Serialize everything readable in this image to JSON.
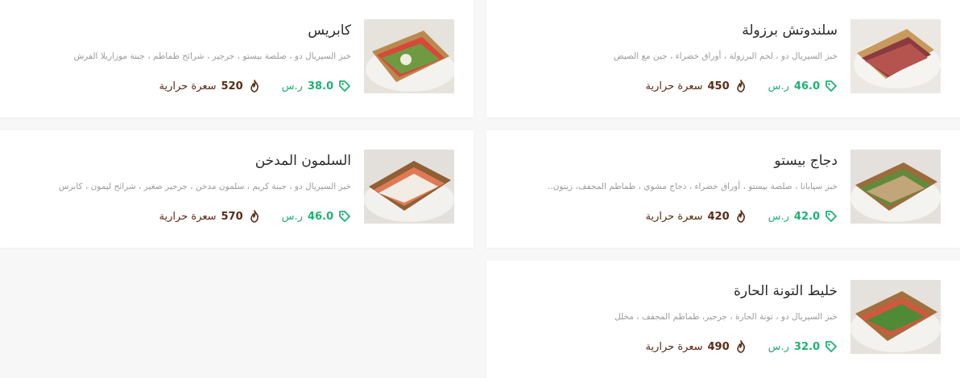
{
  "items": [
    {
      "title": "سلندوتش برزولة",
      "desc": "خبز السيريال دو ، لحم البرزولة ، أوراق خضراء ، جبن مع الصيض",
      "price": "46.0",
      "currency": "ر.س",
      "calories": "450",
      "cal_label": "سعرة حرارية"
    },
    {
      "title": "كابريس",
      "desc": "خبز السيريال دو ، صلصة بيستو ، جرجير ، شرائح طماطم ، جبنة موزاريلا الفرش",
      "price": "38.0",
      "currency": "ر.س",
      "calories": "520",
      "cal_label": "سعرة حرارية"
    },
    {
      "title": "دجاج بيستو",
      "desc": "خبز سيابانا ، صلصة بيستو ، أوراق خضراء ، دجاج مشوي ، طماطم المجفف، زيتون..",
      "price": "42.0",
      "currency": "ر.س",
      "calories": "420",
      "cal_label": "سعرة حرارية"
    },
    {
      "title": "السلمون المدخن",
      "desc": "خبز السيريال دو ، جبنة كريم ، سلمون مدخن ، جرجير صغير ، شرائح ليمون ، كابرس",
      "price": "46.0",
      "currency": "ر.س",
      "calories": "570",
      "cal_label": "سعرة حرارية"
    },
    {
      "title": "خليط التونة الحارة",
      "desc": "خبز السيريال دو ، تونة الحارة ، جرجير، طماطم المجفف ، مخلل",
      "price": "32.0",
      "currency": "ر.س",
      "calories": "490",
      "cal_label": "سعرة حرارية"
    }
  ],
  "icons": {
    "price": "price-tag-icon",
    "calories": "flame-icon"
  },
  "colors": {
    "price": "#1fb173",
    "calories": "#5a2a14",
    "title": "#2b2b2b",
    "desc": "#9a9a9a"
  }
}
